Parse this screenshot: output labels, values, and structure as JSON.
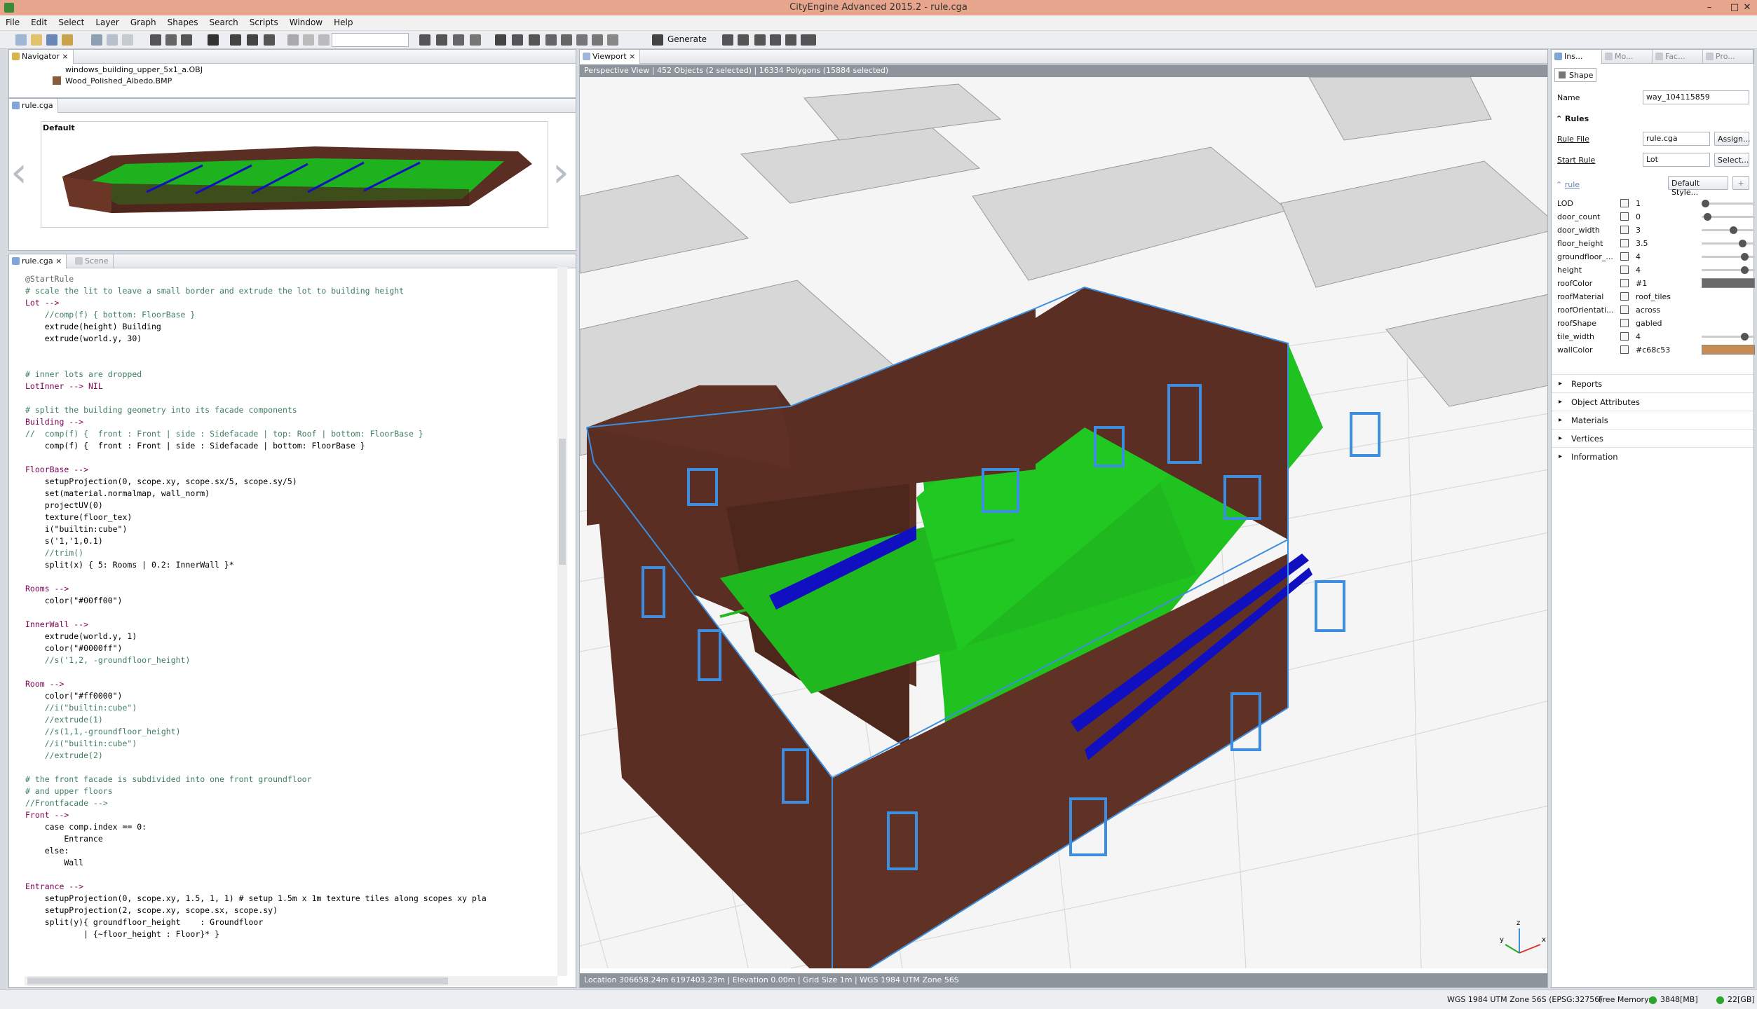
{
  "window": {
    "title": "CityEngine Advanced 2015.2 - rule.cga",
    "minimize": "–",
    "maximize": "□",
    "close": "✕"
  },
  "menu": [
    "File",
    "Edit",
    "Select",
    "Layer",
    "Graph",
    "Shapes",
    "Search",
    "Scripts",
    "Window",
    "Help"
  ],
  "toolbar": {
    "generate_label": "Generate",
    "search_value": ""
  },
  "navigator": {
    "tab": "Navigator",
    "files": [
      "windows_building_upper_5x1_a.OBJ",
      "Wood_Polished_Albedo.BMP"
    ]
  },
  "preview": {
    "tab": "rule.cga",
    "style_label": "Default"
  },
  "editor": {
    "tabs": [
      "rule.cga",
      "Scene"
    ],
    "lines": [
      {
        "t": "@StartRule",
        "c": "ann"
      },
      {
        "t": "# scale the lit to leave a small border and extrude the lot to building height",
        "c": "comment"
      },
      {
        "t": "Lot -->",
        "c": "kw"
      },
      {
        "t": "    //comp(f) { bottom: FloorBase }",
        "c": "comment"
      },
      {
        "t": "    extrude(height) Building",
        "c": "plain"
      },
      {
        "t": "    extrude(world.y, 30)",
        "c": "plain"
      },
      {
        "t": "",
        "c": "plain"
      },
      {
        "t": "",
        "c": "plain"
      },
      {
        "t": "# inner lots are dropped",
        "c": "comment"
      },
      {
        "t": "LotInner --> NIL",
        "c": "kw"
      },
      {
        "t": "",
        "c": "plain"
      },
      {
        "t": "# split the building geometry into its facade components",
        "c": "comment"
      },
      {
        "t": "Building -->",
        "c": "kw"
      },
      {
        "t": "//  comp(f) {  front : Front | side : Sidefacade | top: Roof | bottom: FloorBase }",
        "c": "comment"
      },
      {
        "t": "    comp(f) {  front : Front | side : Sidefacade | bottom: FloorBase }",
        "c": "plain"
      },
      {
        "t": "",
        "c": "plain"
      },
      {
        "t": "FloorBase -->",
        "c": "kw"
      },
      {
        "t": "    setupProjection(0, scope.xy, scope.sx/5, scope.sy/5)",
        "c": "plain"
      },
      {
        "t": "    set(material.normalmap, wall_norm)",
        "c": "plain"
      },
      {
        "t": "    projectUV(0)",
        "c": "plain"
      },
      {
        "t": "    texture(floor_tex)",
        "c": "plain"
      },
      {
        "t": "    i(\"builtin:cube\")",
        "c": "plain"
      },
      {
        "t": "    s('1,'1,0.1)",
        "c": "plain"
      },
      {
        "t": "    //trim()",
        "c": "comment"
      },
      {
        "t": "    split(x) { 5: Rooms | 0.2: InnerWall }*",
        "c": "plain"
      },
      {
        "t": "",
        "c": "plain"
      },
      {
        "t": "Rooms -->",
        "c": "kw"
      },
      {
        "t": "    color(\"#00ff00\")",
        "c": "plain"
      },
      {
        "t": "",
        "c": "plain"
      },
      {
        "t": "InnerWall -->",
        "c": "kw"
      },
      {
        "t": "    extrude(world.y, 1)",
        "c": "plain"
      },
      {
        "t": "    color(\"#0000ff\")",
        "c": "plain"
      },
      {
        "t": "    //s('1,2, -groundfloor_height)",
        "c": "comment"
      },
      {
        "t": "",
        "c": "plain"
      },
      {
        "t": "Room -->",
        "c": "kw"
      },
      {
        "t": "    color(\"#ff0000\")",
        "c": "plain"
      },
      {
        "t": "    //i(\"builtin:cube\")",
        "c": "comment"
      },
      {
        "t": "    //extrude(1)",
        "c": "comment"
      },
      {
        "t": "    //s(1,1,-groundfloor_height)",
        "c": "comment"
      },
      {
        "t": "    //i(\"builtin:cube\")",
        "c": "comment"
      },
      {
        "t": "    //extrude(2)",
        "c": "comment"
      },
      {
        "t": "",
        "c": "plain"
      },
      {
        "t": "# the front facade is subdivided into one front groundfloor",
        "c": "comment"
      },
      {
        "t": "# and upper floors",
        "c": "comment"
      },
      {
        "t": "//Frontfacade -->",
        "c": "comment"
      },
      {
        "t": "Front -->",
        "c": "kw"
      },
      {
        "t": "    case comp.index == 0:",
        "c": "plain"
      },
      {
        "t": "        Entrance",
        "c": "plain"
      },
      {
        "t": "    else:",
        "c": "plain"
      },
      {
        "t": "        Wall",
        "c": "plain"
      },
      {
        "t": "",
        "c": "plain"
      },
      {
        "t": "Entrance -->",
        "c": "kw"
      },
      {
        "t": "    setupProjection(0, scope.xy, 1.5, 1, 1) # setup 1.5m x 1m texture tiles along scopes xy pla",
        "c": "plain"
      },
      {
        "t": "    setupProjection(2, scope.xy, scope.sx, scope.sy)",
        "c": "plain"
      },
      {
        "t": "    split(y){ groundfloor_height    : Groundfloor",
        "c": "plain"
      },
      {
        "t": "            | {~floor_height : Floor}* }",
        "c": "plain"
      }
    ]
  },
  "viewport": {
    "tab": "Viewport",
    "status_line": "Perspective View  |  452 Objects  (2 selected)  |  16334 Polygons  (15884 selected)",
    "bottom_status": "Location 306658.24m 6197403.23m  |  Elevation 0.00m  |  Grid Size 1m  |  WGS 1984 UTM Zone 56S",
    "axis_labels": [
      "z",
      "y",
      "x"
    ]
  },
  "inspector": {
    "tabs": [
      "Ins...",
      "Mo...",
      "Fac...",
      "Pro..."
    ],
    "shape_tab": "Shape",
    "name_label": "Name",
    "name_value": "way_104115859",
    "rules_header": "Rules",
    "rule_file_label": "Rule File",
    "rule_file_value": "rule.cga",
    "assign_button": "Assign...",
    "start_rule_label": "Start Rule",
    "start_rule_value": "Lot",
    "select_button": "Select...",
    "rule_group": "rule",
    "default_style_button": "Default Style...",
    "attributes": [
      {
        "name": "LOD",
        "value": "1",
        "slider": 0.0
      },
      {
        "name": "door_count",
        "value": "0",
        "slider": 0.05
      },
      {
        "name": "door_width",
        "value": "3",
        "slider": 0.6
      },
      {
        "name": "floor_height",
        "value": "3.5",
        "slider": 0.8
      },
      {
        "name": "groundfloor_...",
        "value": "4",
        "slider": 0.85
      },
      {
        "name": "height",
        "value": "4",
        "slider": 0.85
      },
      {
        "name": "roofColor",
        "value": "#1",
        "swatch": "#6a6a6a"
      },
      {
        "name": "roofMaterial",
        "value": "roof_tiles"
      },
      {
        "name": "roofOrientati...",
        "value": "across"
      },
      {
        "name": "roofShape",
        "value": "gabled"
      },
      {
        "name": "tile_width",
        "value": "4",
        "slider": 0.85
      },
      {
        "name": "wallColor",
        "value": "#c68c53",
        "swatch": "#c68c53"
      }
    ],
    "sections": [
      "Reports",
      "Object Attributes",
      "Materials",
      "Vertices",
      "Information"
    ]
  },
  "statusbar": {
    "crs": "WGS 1984 UTM Zone 56S (EPSG:32756)",
    "free_memory_label": "Free Memory:",
    "mem1": "3848[MB]",
    "mem2": "22[GB]"
  },
  "colors": {
    "floor": "#1fc21f",
    "wall": "#5a2e22",
    "outline": "#3d8ee0",
    "innerwall": "#1010c0",
    "ground": "#f2f2f2"
  }
}
